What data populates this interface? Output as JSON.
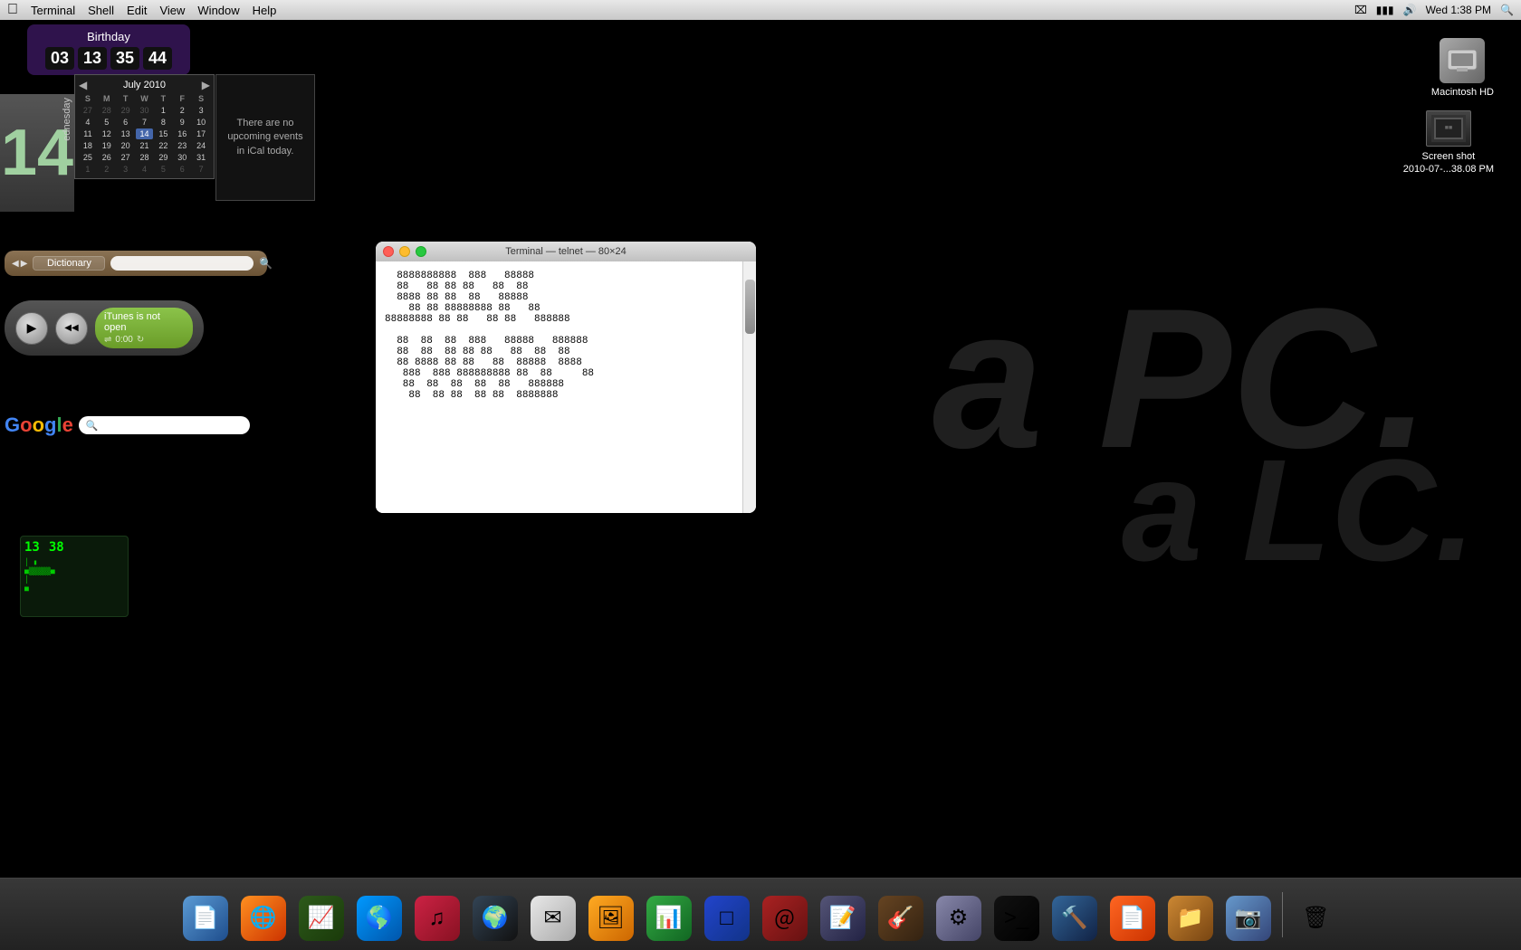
{
  "menubar": {
    "apple": "&#63743;",
    "items": [
      "Terminal",
      "Shell",
      "Edit",
      "View",
      "Window",
      "Help"
    ],
    "right": {
      "bluetooth": "&#8999;",
      "battery_icon": "&#9646;",
      "time": "Wed 1:38 PM",
      "search_icon": "&#128269;"
    }
  },
  "birthday_widget": {
    "title": "Birthday",
    "numbers": [
      "03",
      "13",
      "35",
      "44"
    ]
  },
  "calendar": {
    "day_name": "ednesday",
    "day_number": "14",
    "month_year": "July 2010",
    "day_headers": [
      "S",
      "M",
      "T",
      "W",
      "T",
      "F",
      "S"
    ],
    "weeks": [
      [
        "27",
        "28",
        "29",
        "30",
        "1",
        "2",
        "3"
      ],
      [
        "4",
        "5",
        "6",
        "7",
        "8",
        "9",
        "10"
      ],
      [
        "11",
        "12",
        "13",
        "14",
        "15",
        "16",
        "17"
      ],
      [
        "18",
        "19",
        "20",
        "21",
        "22",
        "23",
        "24"
      ],
      [
        "25",
        "26",
        "27",
        "28",
        "29",
        "30",
        "31"
      ],
      [
        "1",
        "2",
        "3",
        "4",
        "5",
        "6",
        "7"
      ]
    ],
    "ical_text": "There are no upcoming events in iCal today."
  },
  "dictionary": {
    "label": "Dictionary",
    "placeholder": ""
  },
  "itunes": {
    "status": "iTunes is not open",
    "time": "0:00"
  },
  "google": {
    "logo": "Google",
    "placeholder": ""
  },
  "terminal_clock": {
    "hour": "13",
    "minute": "38"
  },
  "macintosh_hd": {
    "label": "Macintosh HD"
  },
  "screenshot": {
    "label": "Screen shot\n2010-07-...38.08 PM"
  },
  "terminal_window": {
    "title": "Terminal — telnet — 80×24",
    "content": "  8888888888  888   88888\n  88   88 88 88   88  88\n  8888 88 88  88   88888\n    88 88 88888888 88   88\n88888888 88 88   88 88   888888\n\n  88  88  88  888   88888   888888\n  88  88  88 88 88   88  88  88\n  88 8888 88 88   88  88888  8888\n   888  888 888888888 88  88     88\n   88  88  88  88  88   888888\n    88  88 88  88 88  8888888"
  },
  "dock": {
    "items": [
      {
        "name": "Finder",
        "class": "dock-finder",
        "icon": "&#128196;"
      },
      {
        "name": "Firefox",
        "class": "dock-firefox",
        "icon": "&#127760;"
      },
      {
        "name": "Activity Monitor",
        "class": "dock-activity",
        "icon": "&#128200;"
      },
      {
        "name": "Safari",
        "class": "dock-safari",
        "icon": "&#127758;"
      },
      {
        "name": "iTunes",
        "class": "dock-itunes",
        "icon": "&#9835;"
      },
      {
        "name": "Network",
        "class": "dock-network",
        "icon": "&#127757;"
      },
      {
        "name": "Mail",
        "class": "dock-mail",
        "icon": "&#9993;"
      },
      {
        "name": "Gallery",
        "class": "dock-gallery",
        "icon": "&#128444;"
      },
      {
        "name": "Numbers",
        "class": "dock-numbers",
        "icon": "&#128202;"
      },
      {
        "name": "VMware Fusion",
        "class": "dock-fusion",
        "icon": "&#9633;"
      },
      {
        "name": "Font Book",
        "class": "dock-font",
        "icon": "&#65312;"
      },
      {
        "name": "Script Editor",
        "class": "dock-scripteditor",
        "icon": "&#128221;"
      },
      {
        "name": "GarageBand",
        "class": "dock-guitar",
        "icon": "&#127928;"
      },
      {
        "name": "System Preferences",
        "class": "dock-syspreferences",
        "icon": "&#9881;"
      },
      {
        "name": "Terminal",
        "class": "dock-terminal",
        "icon": "&#62;_"
      },
      {
        "name": "Xcode",
        "class": "dock-xcode",
        "icon": "&#128296;"
      },
      {
        "name": "Pages",
        "class": "dock-pages",
        "icon": "&#128196;"
      },
      {
        "name": "Stacks",
        "class": "dock-stacks",
        "icon": "&#128193;"
      },
      {
        "name": "iPhoto",
        "class": "dock-iphoto",
        "icon": "&#128247;"
      },
      {
        "name": "Trash",
        "class": "dock-trash",
        "icon": "&#128465;"
      }
    ]
  },
  "watermark": {
    "pc": "a PC.",
    "lc": "a LC."
  }
}
